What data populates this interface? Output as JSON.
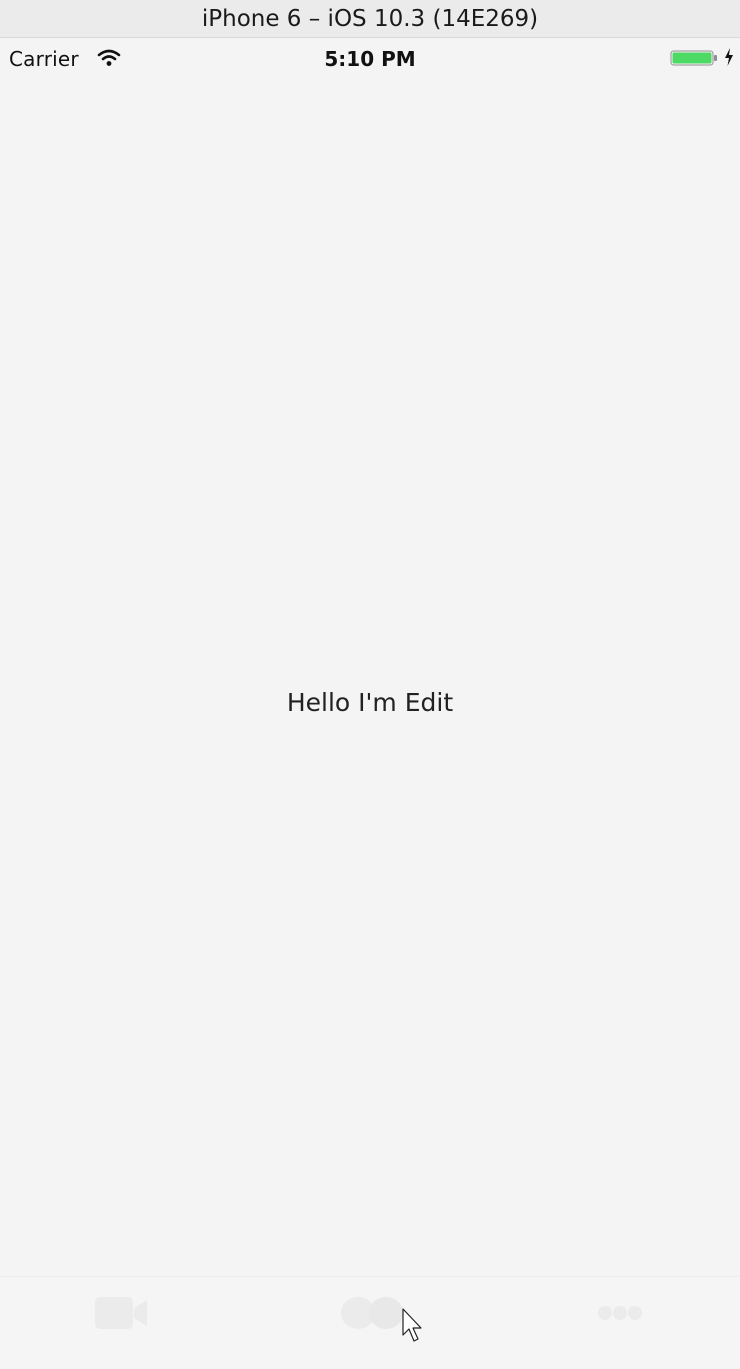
{
  "window": {
    "title": "iPhone 6 – iOS 10.3 (14E269)"
  },
  "status_bar": {
    "carrier": "Carrier",
    "time": "5:10 PM",
    "wifi_icon": "wifi-icon",
    "battery_icon": "battery-icon",
    "charging_icon": "charging-bolt-icon",
    "battery_color": "#4cd964"
  },
  "content": {
    "label": "Hello I'm Edit"
  },
  "tab_bar": {
    "items": [
      {
        "icon": "video-camera-icon"
      },
      {
        "icon": "chat-bubbles-icon"
      },
      {
        "icon": "more-dots-icon"
      }
    ],
    "icon_color": "#ececec"
  },
  "cursor": {
    "icon": "mouse-pointer-icon"
  }
}
